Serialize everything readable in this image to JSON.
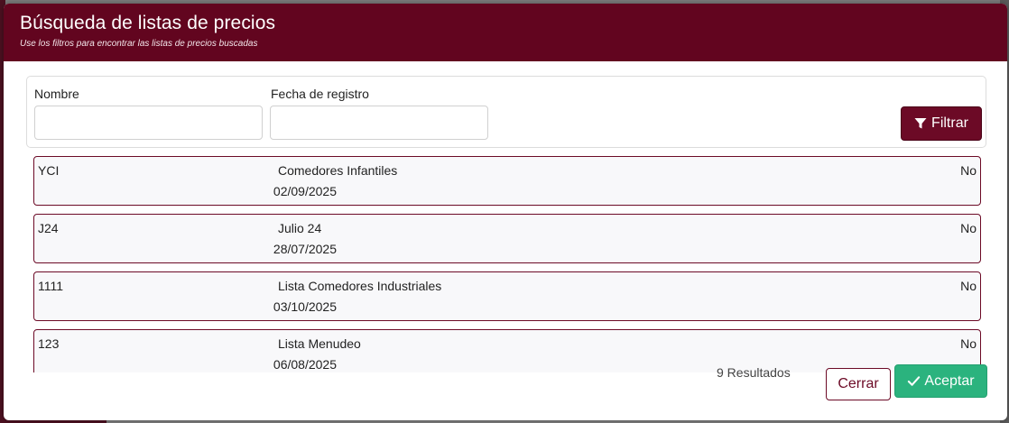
{
  "modal": {
    "title": "Búsqueda de listas de precios",
    "subtitle": "Use los filtros para encontrar las listas de precios buscadas"
  },
  "filters": {
    "name_label": "Nombre",
    "name_value": "",
    "date_label": "Fecha de registro",
    "date_value": "",
    "filter_button": "Filtrar",
    "filter_icon": "funnel-icon"
  },
  "results": [
    {
      "code": "YCI",
      "name": "Comedores Infantiles",
      "date": "02/09/2025",
      "flag": "No"
    },
    {
      "code": "J24",
      "name": "Julio 24",
      "date": "28/07/2025",
      "flag": "No"
    },
    {
      "code": "1111",
      "name": "Lista Comedores Industriales",
      "date": "03/10/2025",
      "flag": "No"
    },
    {
      "code": "123",
      "name": "Lista Menudeo",
      "date": "06/08/2025",
      "flag": "No"
    }
  ],
  "footer": {
    "result_count": "9 Resultados",
    "close_button": "Cerrar",
    "accept_button": "Aceptar",
    "accept_icon": "check-icon"
  },
  "colors": {
    "header": "#62051f",
    "primary_button": "#6c0a26",
    "accept_button": "#2bb37e"
  }
}
